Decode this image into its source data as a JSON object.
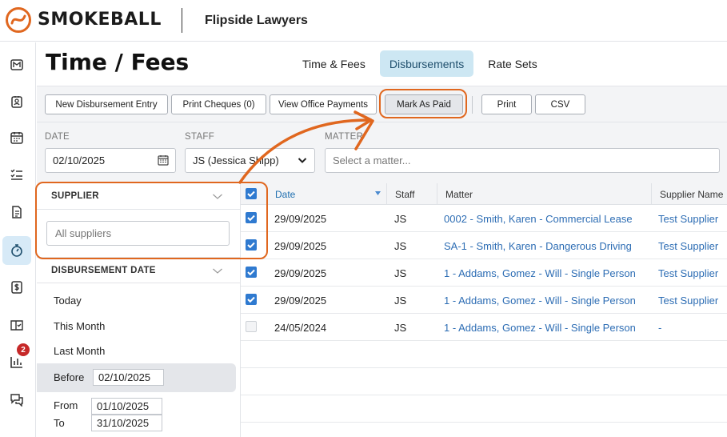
{
  "header": {
    "brand": "SMOKEBALL",
    "firm": "Flipside Lawyers"
  },
  "page": {
    "title": "Time / Fees"
  },
  "tabs": [
    {
      "label": "Time & Fees",
      "active": false
    },
    {
      "label": "Disbursements",
      "active": true
    },
    {
      "label": "Rate Sets",
      "active": false
    }
  ],
  "toolbar": {
    "new_entry": "New Disbursement Entry",
    "print_cheques": "Print Cheques (0)",
    "view_office": "View Office Payments",
    "mark_paid": "Mark As Paid",
    "print": "Print",
    "csv": "CSV"
  },
  "filters": {
    "date_label": "DATE",
    "date_value": "02/10/2025",
    "staff_label": "STAFF",
    "staff_value": "JS (Jessica Shipp)",
    "matter_label": "MATTER",
    "matter_placeholder": "Select a matter..."
  },
  "left_panel": {
    "supplier_header": "SUPPLIER",
    "supplier_placeholder": "All suppliers",
    "disb_date_header": "DISBURSEMENT DATE",
    "options": [
      "Today",
      "This Month",
      "Last Month"
    ],
    "before_label": "Before",
    "before_value": "02/10/2025",
    "from_label": "From",
    "from_value": "01/10/2025",
    "to_label": "To",
    "to_value": "31/10/2025"
  },
  "rail": {
    "notification_count": "2"
  },
  "table": {
    "columns": [
      "Date",
      "Staff",
      "Matter",
      "Supplier Name"
    ],
    "rows": [
      {
        "checked": true,
        "date": "29/09/2025",
        "staff": "JS",
        "matter": "0002 - Smith, Karen - Commercial Lease",
        "supplier": "Test Supplier"
      },
      {
        "checked": true,
        "date": "29/09/2025",
        "staff": "JS",
        "matter": "SA-1 - Smith, Karen - Dangerous Driving",
        "supplier": "Test Supplier"
      },
      {
        "checked": true,
        "date": "29/09/2025",
        "staff": "JS",
        "matter": "1 - Addams, Gomez - Will - Single Person",
        "supplier": "Test Supplier"
      },
      {
        "checked": true,
        "date": "29/09/2025",
        "staff": "JS",
        "matter": "1 - Addams, Gomez - Will - Single Person",
        "supplier": "Test Supplier"
      },
      {
        "checked": false,
        "date": "24/05/2024",
        "staff": "JS",
        "matter": "1 - Addams, Gomez - Will - Single Person",
        "supplier": "-"
      }
    ]
  },
  "colors": {
    "accent": "#2f7ad0",
    "highlight": "#e0671f",
    "tab_active": "#cde7f3"
  }
}
